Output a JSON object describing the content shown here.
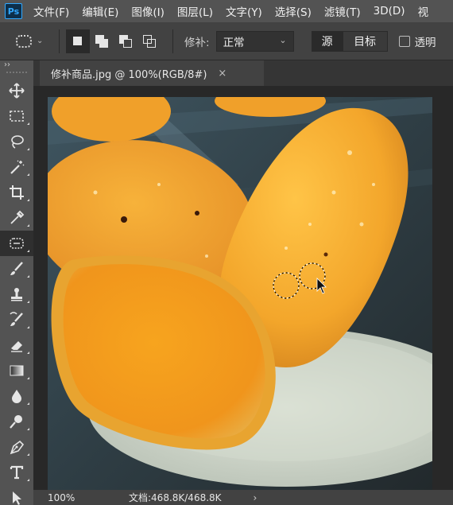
{
  "app": {
    "logo_text": "Ps"
  },
  "menu": [
    "文件(F)",
    "编辑(E)",
    "图像(I)",
    "图层(L)",
    "文字(Y)",
    "选择(S)",
    "滤镜(T)",
    "3D(D)",
    "视"
  ],
  "options_bar": {
    "patch_label": "修补:",
    "patch_mode_value": "正常",
    "source_label": "源",
    "destination_label": "目标",
    "transparent_label": "透明",
    "transparent_checked": false
  },
  "toolbar": {
    "collapse_glyph": "››",
    "tools": [
      "move-tool",
      "marquee-tool",
      "lasso-tool",
      "quick-selection-tool",
      "crop-tool",
      "eyedropper-tool",
      "patch-tool",
      "brush-tool",
      "clone-stamp-tool",
      "history-brush-tool",
      "eraser-tool",
      "gradient-tool",
      "blur-tool",
      "dodge-tool",
      "pen-tool",
      "type-tool",
      "path-selection-tool"
    ],
    "active_tool": "patch-tool"
  },
  "document": {
    "tab_title": "修补商品.jpg @ 100%(RGB/8#)",
    "close_glyph": "×"
  },
  "status": {
    "zoom": "100%",
    "doc_size": "文档:468.8K/468.8K",
    "arrow_glyph": "›"
  },
  "colors": {
    "menubar": "#535353",
    "panel": "#424242",
    "canvas_bg": "#282828",
    "accent": "#31a8ff",
    "mango": "#f3a62b"
  }
}
